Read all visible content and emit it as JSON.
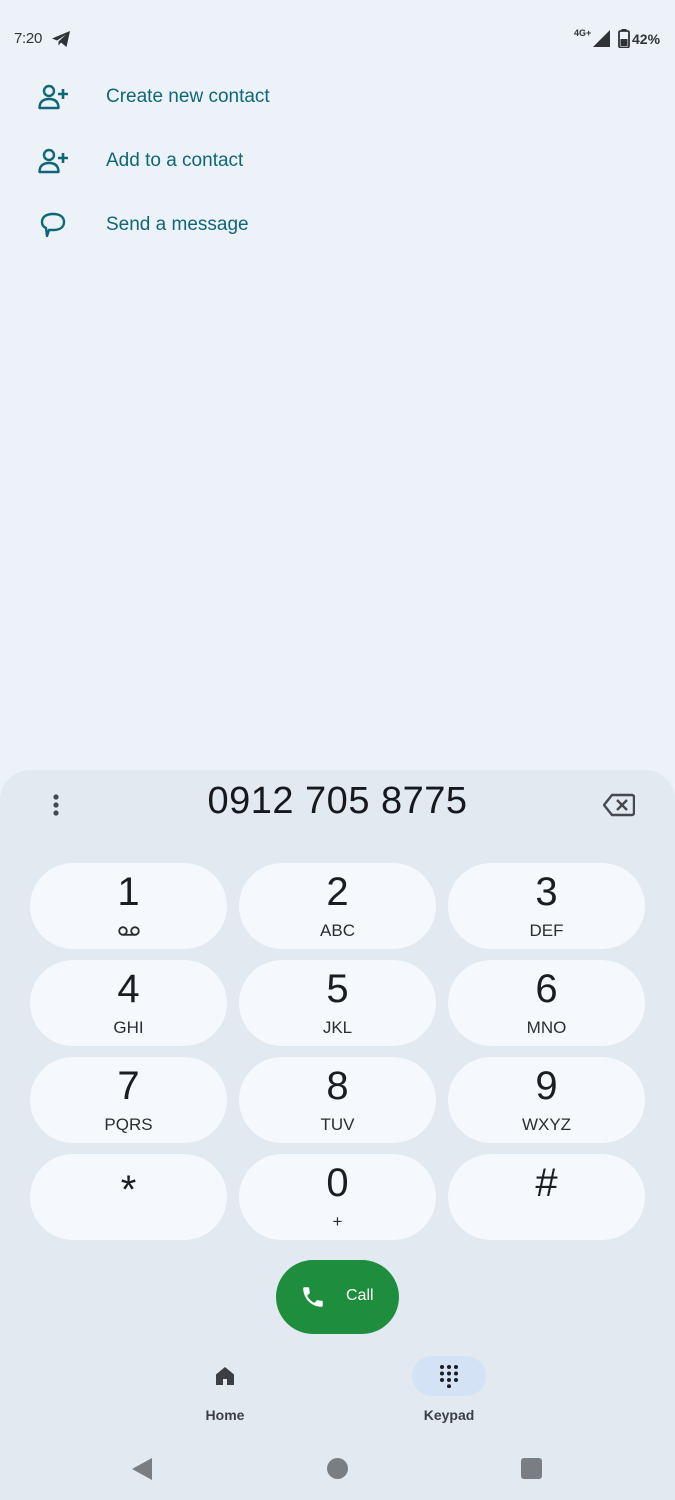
{
  "status_bar": {
    "time": "7:20",
    "network": "4G+",
    "battery": "42%",
    "icons": [
      "telegram-icon",
      "signal-icon",
      "battery-icon"
    ]
  },
  "actions": [
    {
      "label": "Create new contact",
      "icon": "add-person-icon"
    },
    {
      "label": "Add to a contact",
      "icon": "add-person-icon"
    },
    {
      "label": "Send a message",
      "icon": "message-bubble-icon"
    }
  ],
  "dialer": {
    "number": "0912 705 8775",
    "keys": [
      {
        "digit": "1",
        "letters": ""
      },
      {
        "digit": "2",
        "letters": "ABC"
      },
      {
        "digit": "3",
        "letters": "DEF"
      },
      {
        "digit": "4",
        "letters": "GHI"
      },
      {
        "digit": "5",
        "letters": "JKL"
      },
      {
        "digit": "6",
        "letters": "MNO"
      },
      {
        "digit": "7",
        "letters": "PQRS"
      },
      {
        "digit": "8",
        "letters": "TUV"
      },
      {
        "digit": "9",
        "letters": "WXYZ"
      },
      {
        "digit": "*",
        "letters": ""
      },
      {
        "digit": "0",
        "letters": "+"
      },
      {
        "digit": "#",
        "letters": ""
      }
    ],
    "call_label": "Call"
  },
  "bottom_nav": {
    "items": [
      {
        "label": "Home",
        "icon": "home-icon",
        "active": false
      },
      {
        "label": "Keypad",
        "icon": "keypad-icon",
        "active": true
      }
    ]
  },
  "colors": {
    "accent": "#0e6777",
    "call_green": "#1e8e3e",
    "background": "#edf2f9",
    "sheet": "#e3e9f1",
    "key": "#f5f8fc",
    "active_pill": "#d3e3f5"
  }
}
